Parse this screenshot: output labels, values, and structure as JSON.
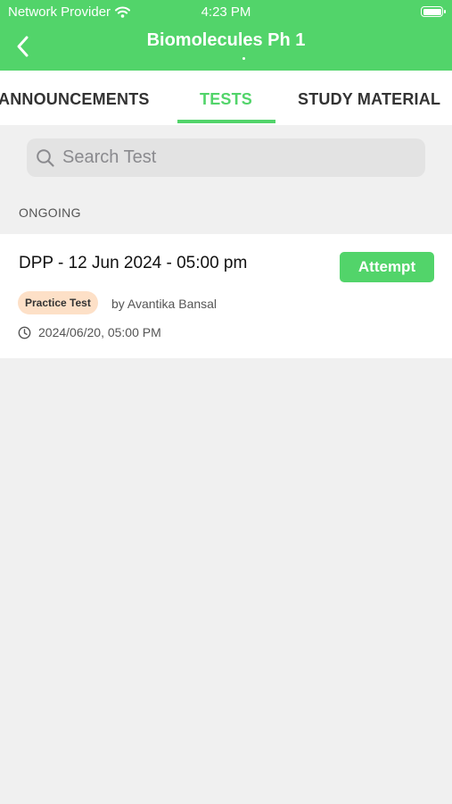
{
  "status_bar": {
    "carrier": "Network Provider",
    "time": "4:23 PM",
    "wifi_icon": "wifi-icon",
    "battery_icon": "battery-icon"
  },
  "nav": {
    "title": "Biomolecules Ph 1",
    "back_icon": "chevron-left-icon"
  },
  "tabs": [
    {
      "label": "ANNOUNCEMENTS",
      "active": false
    },
    {
      "label": "TESTS",
      "active": true
    },
    {
      "label": "STUDY MATERIAL",
      "active": false
    }
  ],
  "search": {
    "placeholder": "Search Test",
    "value": ""
  },
  "sections": [
    {
      "label": "ONGOING",
      "items": [
        {
          "title": "DPP - 12 Jun 2024 - 05:00 pm",
          "action_label": "Attempt",
          "type_badge": "Practice Test",
          "author": "by Avantika Bansal",
          "schedule": "2024/06/20, 05:00 PM"
        }
      ]
    }
  ],
  "colors": {
    "accent": "#52d46a",
    "badge_bg": "#fde0c7",
    "background": "#f0f0f0"
  }
}
